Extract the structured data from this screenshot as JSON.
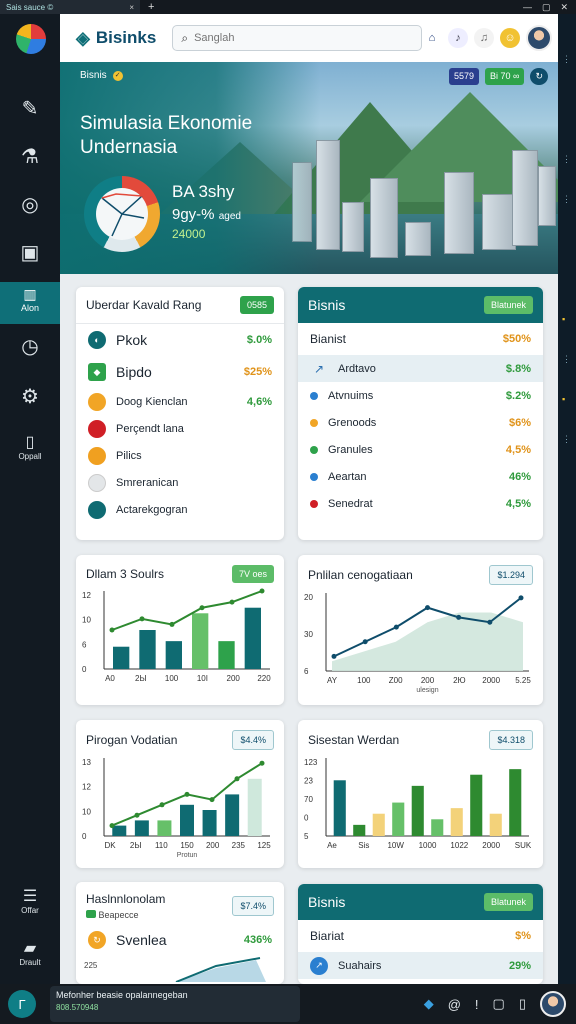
{
  "browser": {
    "tab_title": "Sais sauce ©",
    "close": "×",
    "new_tab": "+",
    "controls": [
      "—",
      "▢",
      "✕"
    ]
  },
  "header": {
    "brand": "Bisinks",
    "search_placeholder": "Sanglah"
  },
  "hero": {
    "brand": "Bisnis",
    "chip_1": "5579",
    "chip_2": "Bi 70 ∞",
    "title": "Simulasia Ekonomie Undernasia",
    "stat_1": "BA 3shy",
    "stat_2": "9gy-%",
    "stat_2_suffix": "aged",
    "stat_3": "24000"
  },
  "sidebar": {
    "active_label": "Alon",
    "foot_1": "Oppall",
    "foot_2": "Offar",
    "foot_3": "Drault"
  },
  "card_left": {
    "title": "Uberdar Kavald Rang",
    "badge": "0585",
    "rows": [
      {
        "label": "Pkok",
        "value": "$.0%"
      },
      {
        "label": "Bipdo",
        "value": "$25%"
      },
      {
        "label": "Doog Kienclan",
        "value": "4,6%"
      },
      {
        "label": "Perçendt lana",
        "value": ""
      },
      {
        "label": "Pilics",
        "value": ""
      },
      {
        "label": "Smreranican",
        "value": ""
      },
      {
        "label": "Actarekgogran",
        "value": ""
      }
    ]
  },
  "card_right": {
    "title": "Bisnis",
    "badge": "Blatunek",
    "rows": [
      {
        "label": "Bianist",
        "value": "$50%"
      },
      {
        "label": "Ardtavo",
        "value": "$.8%"
      },
      {
        "label": "Atvnuims",
        "value": "$.2%"
      },
      {
        "label": "Grenoods",
        "value": "$6%"
      },
      {
        "label": "Granules",
        "value": "4,5%"
      },
      {
        "label": "Aeartan",
        "value": "46%"
      },
      {
        "label": "Senedrat",
        "value": "4,5%"
      }
    ]
  },
  "chart1": {
    "title": "Dllam 3 Soulrs",
    "badge": "7V oes",
    "chart_data": {
      "type": "bar",
      "categories": [
        "A0",
        "2Ы",
        "100",
        "10І",
        "200",
        "220"
      ],
      "values": [
        4,
        7,
        5,
        10,
        5,
        11
      ],
      "line": [
        7,
        9,
        8,
        11,
        12,
        14
      ],
      "ytick_labels": [
        "0",
        "6",
        "10",
        "12"
      ],
      "ylim": [
        0,
        14
      ]
    }
  },
  "chart2": {
    "title": "Pnlilan cenogatiaan",
    "badge": "$1.294",
    "chart_data": {
      "type": "area",
      "categories": [
        "AY",
        "100",
        "Z00",
        "200",
        "2Ю",
        "2000",
        "5.25"
      ],
      "x_annotation": "ulesign",
      "area": [
        2,
        4,
        6,
        10,
        12,
        12,
        10
      ],
      "line": [
        3,
        6,
        9,
        13,
        11,
        10,
        15
      ],
      "ytick_labels": [
        "6",
        "30",
        "20"
      ],
      "ylim": [
        0,
        16
      ]
    }
  },
  "chart3": {
    "title": "Pirogan Vodatian",
    "badge": "$4.4%",
    "chart_data": {
      "type": "bar",
      "categories": [
        "DK",
        "2Ы",
        "110",
        "150",
        "200",
        "235",
        "125"
      ],
      "x_annotation": "Protun",
      "values": [
        2,
        3,
        3,
        6,
        5,
        8,
        11
      ],
      "line": [
        2,
        4,
        6,
        8,
        7,
        11,
        14
      ],
      "ytick_labels": [
        "0",
        "10",
        "12",
        "13"
      ],
      "ylim": [
        0,
        15
      ]
    }
  },
  "chart4": {
    "title": "Sisestan Werdan",
    "badge": "$4.318",
    "chart_data": {
      "type": "bar",
      "categories": [
        "Ae",
        "Sis",
        "10W",
        "1000",
        "1022",
        "2000",
        "SUK"
      ],
      "values": [
        10,
        2,
        4,
        6,
        9,
        3,
        5,
        11,
        4,
        12
      ],
      "ytick_labels": [
        "5",
        "0",
        "70",
        "23",
        "123"
      ],
      "ylim": [
        0,
        14
      ]
    }
  },
  "card_bottom_left": {
    "title": "Haslnnlonolam",
    "subtitle": "Beapecce",
    "badge": "$7.4%",
    "row_label": "Svenlea",
    "row_value": "436%",
    "ytick": "225"
  },
  "card_bottom_right": {
    "title": "Bisnis",
    "badge": "Blatunek",
    "rows": [
      {
        "label": "Biariat",
        "value": "$%"
      },
      {
        "label": "Suahairs",
        "value": "29%"
      }
    ]
  },
  "taskbar": {
    "toast_title": "Mefonher beasie opalannegeban",
    "toast_sub": "808.570948"
  },
  "colors": {
    "teal": "#0f6b72",
    "green": "#2ea24b",
    "orange": "#e0931a",
    "sidebar": "#121a22"
  }
}
